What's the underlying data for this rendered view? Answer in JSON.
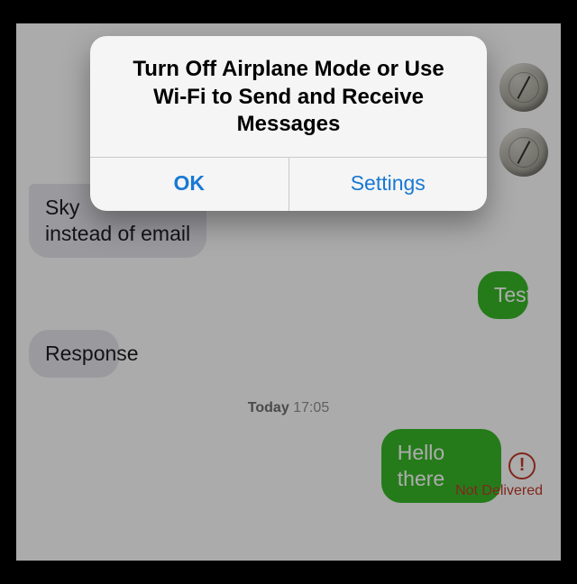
{
  "alert": {
    "title": "Turn Off Airplane Mode or Use Wi-Fi to Send and Receive Messages",
    "ok_label": "OK",
    "settings_label": "Settings"
  },
  "chat": {
    "bubble_incoming_partial": "Sky\ninstead of email",
    "bubble_incoming_partial_line1": "Sky",
    "bubble_incoming_partial_line2": "instead of email",
    "bubble_test": "Test",
    "bubble_response": "Response",
    "bubble_hello": "Hello there"
  },
  "timestamp": {
    "day": "Today",
    "time": "17:05"
  },
  "status": {
    "not_delivered": "Not Delivered"
  },
  "icons": {
    "compass": "compass-icon",
    "alert_error": "!"
  },
  "colors": {
    "ios_blue": "#1978d4",
    "sms_green": "#37b627",
    "error_red": "#c0392b",
    "bubble_grey": "#e4e4e9"
  }
}
